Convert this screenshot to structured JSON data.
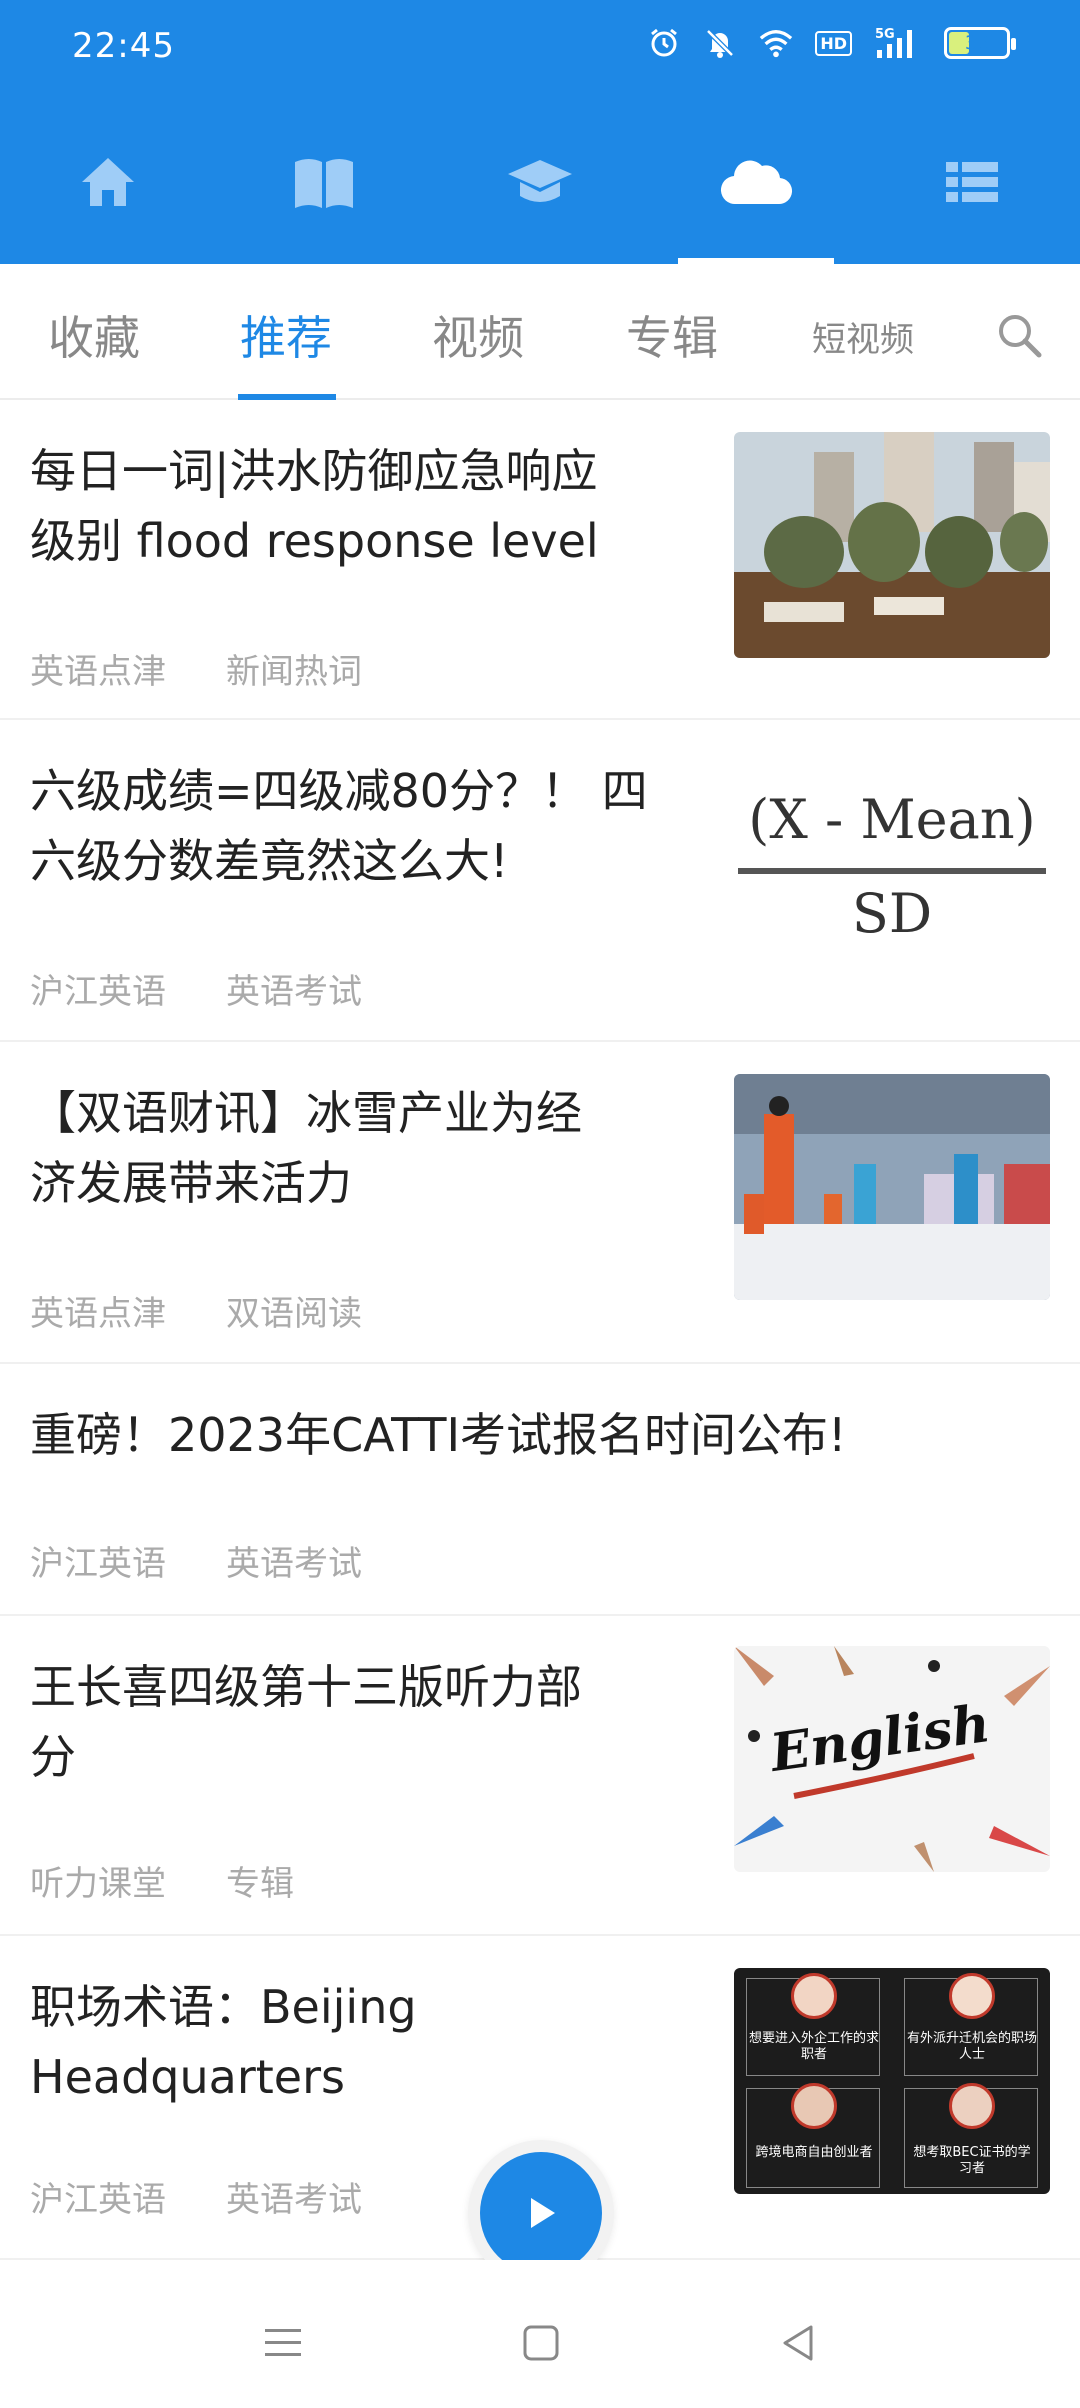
{
  "status_bar": {
    "time": "22:45",
    "battery": "33",
    "hd_label": "HD",
    "signal_label": "5G",
    "icons": [
      "alarm-icon",
      "mute-icon",
      "wifi-icon",
      "hd-icon",
      "signal-5g-icon",
      "battery-icon"
    ]
  },
  "nav": {
    "items": [
      {
        "name": "home-icon",
        "active": false
      },
      {
        "name": "book-icon",
        "active": false
      },
      {
        "name": "graduation-cap-icon",
        "active": false
      },
      {
        "name": "cloud-icon",
        "active": true
      },
      {
        "name": "list-icon",
        "active": false
      }
    ]
  },
  "tabs": {
    "items": [
      {
        "label": "收藏",
        "active": false
      },
      {
        "label": "推荐",
        "active": true
      },
      {
        "label": "视频",
        "active": false
      },
      {
        "label": "专辑",
        "active": false
      },
      {
        "label": "短视频",
        "active": false
      }
    ],
    "search_icon": "search-icon"
  },
  "articles": [
    {
      "title": "每日一词|洪水防御应急响应级别 flood response level",
      "title_lines": [
        "每日一词|洪水防御应急响应",
        "级别 flood response level"
      ],
      "tags": [
        "英语点津",
        "新闻热词"
      ],
      "thumbnail": "soldiers-sandbags-photo"
    },
    {
      "title": "六级成绩=四级减80分？！四六级分数差竟然这么大!",
      "title_lines": [
        "六级成绩=四级减80分？！ 四",
        "六级分数差竟然这么大!"
      ],
      "tags": [
        "沪江英语",
        "英语考试"
      ],
      "thumbnail": "formula-image",
      "thumb_text": {
        "numerator": "(X - Mean)",
        "denominator": "SD"
      }
    },
    {
      "title": "【双语财讯】冰雪产业为经济发展带来活力",
      "title_lines": [
        "【双语财讯】冰雪产业为经",
        "济发展带来活力"
      ],
      "tags": [
        "英语点津",
        "双语阅读"
      ],
      "thumbnail": "ski-photo"
    },
    {
      "title": "重磅！2023年CATTI考试报名时间公布!",
      "title_lines": [
        "重磅！2023年CATTI考试报名时间公布!"
      ],
      "tags": [
        "沪江英语",
        "英语考试"
      ],
      "thumbnail": null
    },
    {
      "title": "王长喜四级第十三版听力部分",
      "title_lines": [
        "王长喜四级第十三版听力部",
        "分"
      ],
      "tags": [
        "听力课堂",
        "专辑"
      ],
      "thumbnail": "english-word-photo",
      "thumb_text": {
        "word": "English"
      }
    },
    {
      "title": "职场术语：Beijing Headquarters",
      "title_lines": [
        "职场术语：Beijing",
        "Headquarters"
      ],
      "tags": [
        "沪江英语",
        "英语考试"
      ],
      "thumbnail": "career-grid-image",
      "thumb_text": {
        "cells": [
          "想要进入外企工作的求职者",
          "有外派升迁机会的职场人士",
          "跨境电商自由创业者",
          "想考取BEC证书的学习者"
        ]
      }
    }
  ],
  "player": {
    "icon": "play-icon"
  },
  "system_nav": {
    "icons": [
      "menu-icon",
      "home-square-icon",
      "back-icon"
    ]
  }
}
